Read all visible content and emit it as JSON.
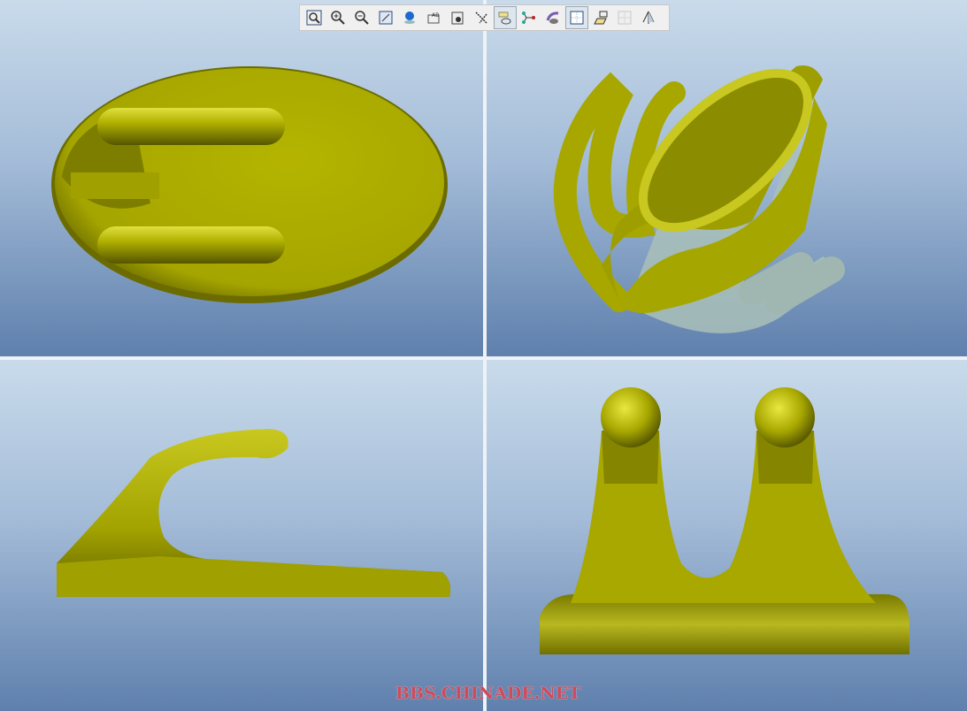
{
  "toolbar": {
    "buttons": [
      {
        "name": "refit",
        "icon": "zoom-fit-icon",
        "active": false
      },
      {
        "name": "zoom-in",
        "icon": "zoom-in-icon",
        "active": false
      },
      {
        "name": "zoom-out",
        "icon": "zoom-out-icon",
        "active": false
      },
      {
        "name": "repaint",
        "icon": "repaint-icon",
        "active": false
      },
      {
        "name": "display-style",
        "icon": "shading-icon",
        "active": false
      },
      {
        "name": "saved-views",
        "icon": "saved-views-icon",
        "active": false
      },
      {
        "name": "view-manager",
        "icon": "view-manager-icon",
        "active": false
      },
      {
        "name": "datum-display",
        "icon": "datum-display-icon",
        "active": false
      },
      {
        "name": "spin-center",
        "icon": "spin-center-icon",
        "active": true
      },
      {
        "name": "csys-display",
        "icon": "csys-icon",
        "active": false
      },
      {
        "name": "annotation-display",
        "icon": "annotation-icon",
        "active": false
      },
      {
        "name": "multi-view",
        "icon": "multi-view-icon",
        "active": true
      },
      {
        "name": "orient",
        "icon": "orient-icon",
        "active": false
      },
      {
        "name": "grid",
        "icon": "grid-icon",
        "active": false,
        "disabled": true
      },
      {
        "name": "plane-display",
        "icon": "plane-icon",
        "active": false
      }
    ]
  },
  "colors": {
    "model": "#a8a800",
    "background_top": "#c9dbeb",
    "background_bottom": "#5f80ad"
  },
  "watermark": "BBS.CHINADE.NET"
}
